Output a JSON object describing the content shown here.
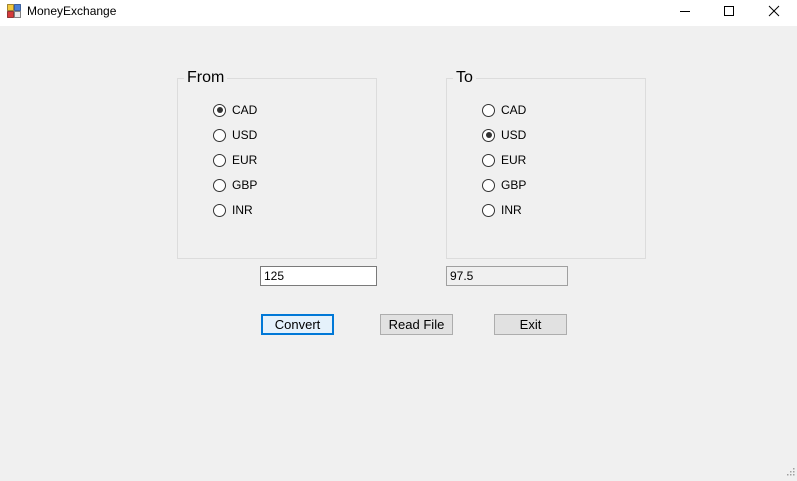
{
  "window": {
    "title": "MoneyExchange",
    "icon": "app-icon",
    "controls": [
      "minimize-icon",
      "maximize-icon",
      "close-icon"
    ]
  },
  "from_group": {
    "legend": "From",
    "options": [
      "CAD",
      "USD",
      "EUR",
      "GBP",
      "INR"
    ],
    "selected": "CAD"
  },
  "to_group": {
    "legend": "To",
    "options": [
      "CAD",
      "USD",
      "EUR",
      "GBP",
      "INR"
    ],
    "selected": "USD"
  },
  "amount_input": {
    "value": "125"
  },
  "result_output": {
    "value": "97.5"
  },
  "buttons": {
    "convert": "Convert",
    "read_file": "Read File",
    "exit": "Exit"
  },
  "colors": {
    "background": "#f0f0f0",
    "titlebar": "#ffffff",
    "focus_border": "#0078d7",
    "button_face": "#e1e1e1"
  }
}
